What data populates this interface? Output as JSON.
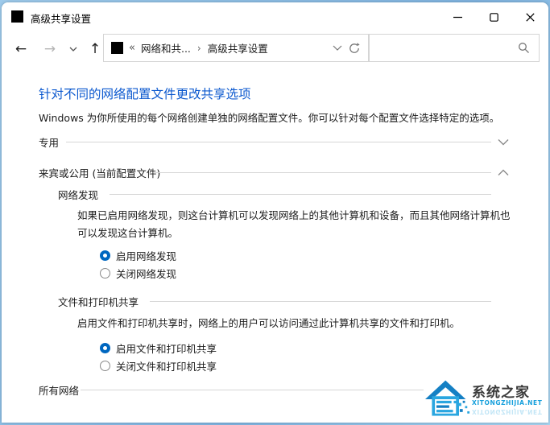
{
  "titlebar": {
    "title": "高级共享设置"
  },
  "navbar": {
    "breadcrumb": {
      "overflow": "«",
      "parent": "网络和共...",
      "separator": "›",
      "current": "高级共享设置"
    },
    "search": {
      "value": ""
    }
  },
  "content": {
    "heading": "针对不同的网络配置文件更改共享选项",
    "intro": "Windows 为你所使用的每个网络创建单独的网络配置文件。你可以针对每个配置文件选择特定的选项。",
    "sections": {
      "private": {
        "title": "专用",
        "state": "collapsed"
      },
      "guest_public": {
        "title": "来宾或公用 (当前配置文件)",
        "state": "expanded"
      },
      "all_networks": {
        "title": "所有网络",
        "state": "collapsed"
      }
    },
    "network_discovery": {
      "title": "网络发现",
      "description": "如果已启用网络发现，则这台计算机可以发现网络上的其他计算机和设备，而且其他网络计算机也可以发现这台计算机。",
      "options": [
        {
          "label": "启用网络发现",
          "selected": true
        },
        {
          "label": "关闭网络发现",
          "selected": false
        }
      ]
    },
    "file_printer_sharing": {
      "title": "文件和打印机共享",
      "description": "启用文件和打印机共享时，网络上的用户可以访问通过此计算机共享的文件和打印机。",
      "options": [
        {
          "label": "启用文件和打印机共享",
          "selected": true
        },
        {
          "label": "关闭文件和打印机共享",
          "selected": false
        }
      ]
    }
  },
  "watermark": {
    "name": "系统之家",
    "domain": "XITONGZHIJIA.NET"
  },
  "icons": {
    "back": "←",
    "forward": "→",
    "up": "↑",
    "history-chevron": "⌄",
    "breadcrumb-overflow": "«",
    "breadcrumb-separator": "›",
    "refresh": "⟳",
    "search": "🔍",
    "minimize": "–",
    "maximize": "□",
    "close": "✕",
    "section-collapsed": "⌄",
    "section-expanded": "⌃"
  },
  "colors": {
    "heading_blue": "#0c59cf",
    "radio_accent": "#0067c0",
    "divider_gray": "#d6d6d6",
    "watermark_blue": "#17a0dc",
    "watermark_dark_blue": "#1580c4",
    "text": "#1b1b1b"
  }
}
